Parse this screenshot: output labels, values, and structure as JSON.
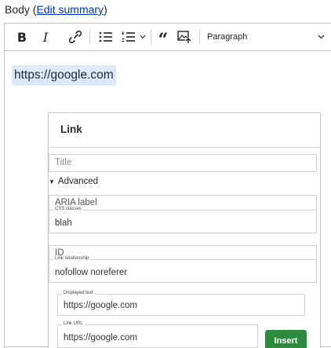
{
  "field": {
    "label": "Body",
    "paren_open": " (",
    "edit_summary_link": "Edit summary",
    "paren_close": ")"
  },
  "toolbar": {
    "icons": [
      "bold-icon",
      "italic-icon",
      "link-icon",
      "bulleted-list-icon",
      "numbered-list-icon",
      "dropdown-arrow-icon",
      "blockquote-icon",
      "insert-image-icon"
    ],
    "heading_select": "Paragraph"
  },
  "editor": {
    "link_text": "https://google.com"
  },
  "link_panel": {
    "title": "Link",
    "title_placeholder": "Title",
    "advanced_label": "Advanced",
    "aria_label_placeholder": "ARIA label",
    "css_classes_label": "CSS classes",
    "css_classes_value": "blah",
    "id_placeholder": "ID",
    "link_relationship_label": "Link relationship",
    "link_relationship_value": "nofollow noreferer",
    "displayed_text_label": "Displayed text",
    "displayed_text_value": "https://google.com",
    "link_url_label": "Link URL",
    "link_url_value": "https://google.com",
    "insert_button": "Insert"
  },
  "colors": {
    "link": "#0036b1",
    "highlight": "#dde9f7",
    "insert_button": "#2e8b3d"
  }
}
